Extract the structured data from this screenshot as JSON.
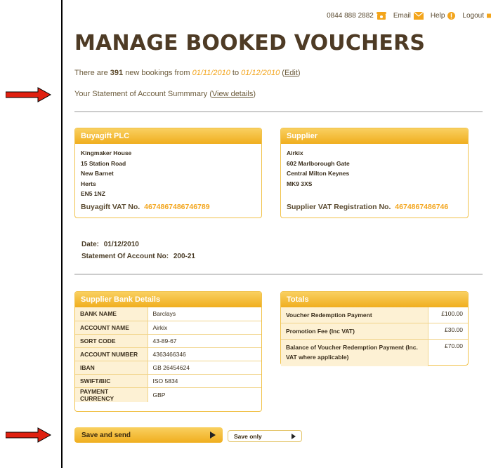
{
  "topnav": {
    "phone": "0844 888 2882",
    "email": "Email",
    "help": "Help",
    "logout": "Logout"
  },
  "title": "MANAGE BOOKED VOUCHERS",
  "summary": {
    "prefix": "There are",
    "count": "391",
    "middle": "new bookings from",
    "from_date": "01/11/2010",
    "to_word": "to",
    "to_date": "01/12/2010",
    "edit_label": "Edit"
  },
  "statement": {
    "text": "Your Statement of Account Summmary",
    "link_label": "View details"
  },
  "buyagift": {
    "title": "Buyagift PLC",
    "address": [
      "Kingmaker House",
      "15 Station Road",
      "New Barnet",
      "Herts",
      "EN5 1NZ"
    ],
    "vat_label": "Buyagift VAT No.",
    "vat_number": "4674867486746789"
  },
  "supplier": {
    "title": "Supplier",
    "address": [
      "Airkix",
      "602 Marlborough Gate",
      "Central Milton Keynes",
      "MK9 3XS"
    ],
    "vat_label": "Supplier VAT Registration No.",
    "vat_number": "4674867486746"
  },
  "date_block": {
    "date_label": "Date:",
    "date_value": "01/12/2010",
    "soa_label": "Statement Of Account No:",
    "soa_value": "200-21"
  },
  "bank": {
    "title": "Supplier Bank Details",
    "rows": [
      {
        "key": "BANK NAME",
        "value": "Barclays"
      },
      {
        "key": "ACCOUNT NAME",
        "value": "Airkix"
      },
      {
        "key": "SORT CODE",
        "value": "43-89-67"
      },
      {
        "key": "ACCOUNT NUMBER",
        "value": "4363466346"
      },
      {
        "key": "IBAN",
        "value": "GB 26454624"
      },
      {
        "key": "SWIFT/BIC",
        "value": "ISO 5834"
      },
      {
        "key": "PAYMENT CURRENCY",
        "value": "GBP"
      }
    ]
  },
  "totals": {
    "title": "Totals",
    "rows": [
      {
        "key": "Voucher Redemption Payment",
        "value": "£100.00"
      },
      {
        "key": "Promotion Fee (Inc VAT)",
        "value": "£30.00"
      },
      {
        "key": "Balance of Voucher Redemption Payment (Inc. VAT where applicable)",
        "value": "£70.00"
      }
    ]
  },
  "buttons": {
    "save_send": "Save and send",
    "save_only": "Save only"
  },
  "colors": {
    "accent": "#f3a51c",
    "header_gradient_top": "#f9d060",
    "header_gradient_bottom": "#f0ae1e",
    "title": "#4e3b25",
    "arrow": "#e02010"
  }
}
